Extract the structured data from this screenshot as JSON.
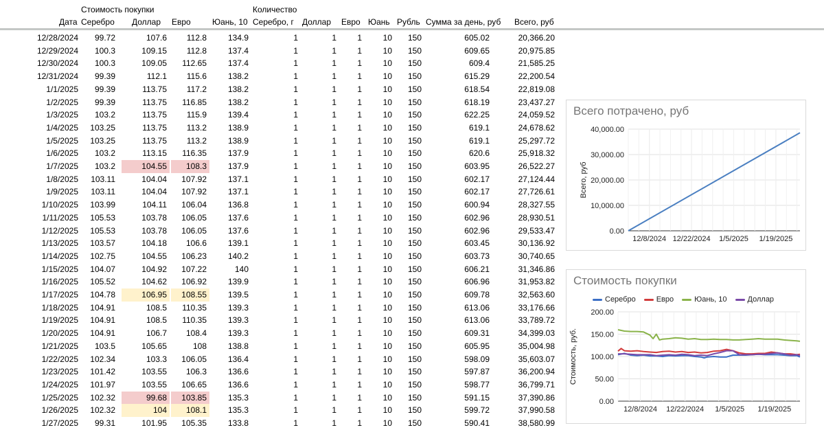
{
  "header": {
    "group_cost": "Стоимость покупки",
    "group_qty": "Количество",
    "columns": [
      "Дата",
      "Серебро",
      "Доллар",
      "Евро",
      "Юань, 10",
      "Серебро, г",
      "Доллар",
      "Евро",
      "Юань",
      "Рубль",
      "Сумма за день, руб",
      "Всего, руб"
    ]
  },
  "rows": [
    [
      "12/28/2024",
      "99.72",
      "107.6",
      "112.8",
      "134.9",
      "1",
      "1",
      "1",
      "10",
      "150",
      "605.02",
      "20,366.20"
    ],
    [
      "12/29/2024",
      "100.3",
      "109.15",
      "112.8",
      "137.4",
      "1",
      "1",
      "1",
      "10",
      "150",
      "609.65",
      "20,975.85"
    ],
    [
      "12/30/2024",
      "100.3",
      "109.05",
      "112.65",
      "137.4",
      "1",
      "1",
      "1",
      "10",
      "150",
      "609.4",
      "21,585.25"
    ],
    [
      "12/31/2024",
      "99.39",
      "112.1",
      "115.6",
      "138.2",
      "1",
      "1",
      "1",
      "10",
      "150",
      "615.29",
      "22,200.54"
    ],
    [
      "1/1/2025",
      "99.39",
      "113.75",
      "117.2",
      "138.2",
      "1",
      "1",
      "1",
      "10",
      "150",
      "618.54",
      "22,819.08"
    ],
    [
      "1/2/2025",
      "99.39",
      "113.75",
      "116.85",
      "138.2",
      "1",
      "1",
      "1",
      "10",
      "150",
      "618.19",
      "23,437.27"
    ],
    [
      "1/3/2025",
      "103.2",
      "113.75",
      "115.9",
      "139.4",
      "1",
      "1",
      "1",
      "10",
      "150",
      "622.25",
      "24,059.52"
    ],
    [
      "1/4/2025",
      "103.25",
      "113.75",
      "113.2",
      "138.9",
      "1",
      "1",
      "1",
      "10",
      "150",
      "619.1",
      "24,678.62"
    ],
    [
      "1/5/2025",
      "103.25",
      "113.75",
      "113.2",
      "138.9",
      "1",
      "1",
      "1",
      "10",
      "150",
      "619.1",
      "25,297.72"
    ],
    [
      "1/6/2025",
      "103.2",
      "113.15",
      "116.35",
      "137.9",
      "1",
      "1",
      "1",
      "10",
      "150",
      "620.6",
      "25,918.32"
    ],
    [
      "1/7/2025",
      "103.2",
      "104.55",
      "108.3",
      "137.9",
      "1",
      "1",
      "1",
      "10",
      "150",
      "603.95",
      "26,522.27"
    ],
    [
      "1/8/2025",
      "103.11",
      "104.04",
      "107.92",
      "137.1",
      "1",
      "1",
      "1",
      "10",
      "150",
      "602.17",
      "27,124.44"
    ],
    [
      "1/9/2025",
      "103.11",
      "104.04",
      "107.92",
      "137.1",
      "1",
      "1",
      "1",
      "10",
      "150",
      "602.17",
      "27,726.61"
    ],
    [
      "1/10/2025",
      "103.99",
      "104.11",
      "106.04",
      "136.8",
      "1",
      "1",
      "1",
      "10",
      "150",
      "600.94",
      "28,327.55"
    ],
    [
      "1/11/2025",
      "105.53",
      "103.78",
      "106.05",
      "137.6",
      "1",
      "1",
      "1",
      "10",
      "150",
      "602.96",
      "28,930.51"
    ],
    [
      "1/12/2025",
      "105.53",
      "103.78",
      "106.05",
      "137.6",
      "1",
      "1",
      "1",
      "10",
      "150",
      "602.96",
      "29,533.47"
    ],
    [
      "1/13/2025",
      "103.57",
      "104.18",
      "106.6",
      "139.1",
      "1",
      "1",
      "1",
      "10",
      "150",
      "603.45",
      "30,136.92"
    ],
    [
      "1/14/2025",
      "102.75",
      "104.55",
      "106.23",
      "140.2",
      "1",
      "1",
      "1",
      "10",
      "150",
      "603.73",
      "30,740.65"
    ],
    [
      "1/15/2025",
      "104.07",
      "104.92",
      "107.22",
      "140",
      "1",
      "1",
      "1",
      "10",
      "150",
      "606.21",
      "31,346.86"
    ],
    [
      "1/16/2025",
      "105.52",
      "104.62",
      "106.92",
      "139.9",
      "1",
      "1",
      "1",
      "10",
      "150",
      "606.96",
      "31,953.82"
    ],
    [
      "1/17/2025",
      "104.78",
      "106.95",
      "108.55",
      "139.5",
      "1",
      "1",
      "1",
      "10",
      "150",
      "609.78",
      "32,563.60"
    ],
    [
      "1/18/2025",
      "104.91",
      "108.5",
      "110.35",
      "139.3",
      "1",
      "1",
      "1",
      "10",
      "150",
      "613.06",
      "33,176.66"
    ],
    [
      "1/19/2025",
      "104.91",
      "108.5",
      "110.35",
      "139.3",
      "1",
      "1",
      "1",
      "10",
      "150",
      "613.06",
      "33,789.72"
    ],
    [
      "1/20/2025",
      "104.91",
      "106.7",
      "108.4",
      "139.3",
      "1",
      "1",
      "1",
      "10",
      "150",
      "609.31",
      "34,399.03"
    ],
    [
      "1/21/2025",
      "103.5",
      "105.65",
      "108",
      "138.8",
      "1",
      "1",
      "1",
      "10",
      "150",
      "605.95",
      "35,004.98"
    ],
    [
      "1/22/2025",
      "102.34",
      "103.3",
      "106.05",
      "136.4",
      "1",
      "1",
      "1",
      "10",
      "150",
      "598.09",
      "35,603.07"
    ],
    [
      "1/23/2025",
      "101.42",
      "103.55",
      "106.3",
      "136.6",
      "1",
      "1",
      "1",
      "10",
      "150",
      "597.87",
      "36,200.94"
    ],
    [
      "1/24/2025",
      "101.97",
      "103.55",
      "106.65",
      "136.6",
      "1",
      "1",
      "1",
      "10",
      "150",
      "598.77",
      "36,799.71"
    ],
    [
      "1/25/2025",
      "102.32",
      "99.68",
      "103.85",
      "135.3",
      "1",
      "1",
      "1",
      "10",
      "150",
      "591.15",
      "37,390.86"
    ],
    [
      "1/26/2025",
      "102.32",
      "104",
      "108.1",
      "135.3",
      "1",
      "1",
      "1",
      "10",
      "150",
      "599.72",
      "37,990.58"
    ],
    [
      "1/27/2025",
      "99.31",
      "101.95",
      "105.35",
      "133.8",
      "1",
      "1",
      "1",
      "10",
      "150",
      "590.41",
      "38,580.99"
    ]
  ],
  "highlights": [
    {
      "row": 10,
      "cols": [
        2,
        3
      ],
      "color": "#f4cccc"
    },
    {
      "row": 20,
      "cols": [
        2,
        3
      ],
      "color": "#fff2cc"
    },
    {
      "row": 28,
      "cols": [
        2,
        3
      ],
      "color": "#f4cccc"
    },
    {
      "row": 29,
      "cols": [
        2,
        3
      ],
      "color": "#fff2cc"
    }
  ],
  "chart_data": [
    {
      "type": "line",
      "title": "Всего потрачено, руб",
      "ylabel": "Всего, руб",
      "xlabel": "",
      "ylim": [
        0,
        40000
      ],
      "yticks": [
        "0.00",
        "10,000.00",
        "20,000.00",
        "30,000.00",
        "40,000.00"
      ],
      "xticks": [
        "12/8/2024",
        "12/22/2024",
        "1/5/2025",
        "1/19/2025"
      ],
      "xtick_days": [
        7,
        21,
        35,
        49
      ],
      "xrange_days": [
        0,
        57
      ],
      "series": [
        {
          "color": "#4a7fc1",
          "x_days": [
            0,
            57
          ],
          "values": [
            0,
            38580.99
          ]
        }
      ],
      "grid": true,
      "legend": "none"
    },
    {
      "type": "line",
      "title": "Стоимость покупки",
      "ylabel": "Стоимость, руб.",
      "xlabel": "",
      "ylim": [
        0,
        200
      ],
      "yticks": [
        "0.00",
        "50.00",
        "100.00",
        "150.00",
        "200.00"
      ],
      "xticks": [
        "12/8/2024",
        "12/22/2024",
        "1/5/2025",
        "1/19/2025"
      ],
      "xtick_days": [
        7,
        21,
        35,
        49
      ],
      "xrange_days": [
        0,
        57
      ],
      "legend": "top",
      "grid": true,
      "series": [
        {
          "name": "Серебро",
          "color": "#3b6fc6",
          "x_days": [
            0,
            2,
            4,
            6,
            8,
            10,
            12,
            14,
            16,
            18,
            20,
            22,
            24,
            26,
            27,
            28,
            30,
            32,
            34,
            36,
            38,
            40,
            42,
            44,
            46,
            48,
            50,
            52,
            54,
            56,
            57
          ],
          "values": [
            104,
            107,
            103,
            102,
            103,
            101,
            101,
            100,
            102,
            101,
            102,
            102,
            100,
            99,
            97,
            99,
            100,
            99,
            99,
            103,
            103,
            103,
            104,
            105,
            104,
            104,
            104,
            103,
            102,
            102,
            99
          ]
        },
        {
          "name": "Евро",
          "color": "#d23b3b",
          "x_days": [
            0,
            1,
            2,
            4,
            6,
            8,
            10,
            12,
            14,
            16,
            18,
            20,
            22,
            24,
            26,
            28,
            30,
            32,
            34,
            36,
            38,
            40,
            42,
            44,
            46,
            48,
            50,
            52,
            54,
            56,
            57
          ],
          "values": [
            112,
            118,
            113,
            112,
            113,
            111,
            110,
            109,
            111,
            112,
            110,
            111,
            109,
            110,
            108,
            109,
            112,
            113,
            116,
            113,
            108,
            106,
            106,
            107,
            107,
            110,
            108,
            106,
            106,
            104,
            105
          ]
        },
        {
          "name": "Юань, 10",
          "color": "#8ab34a",
          "x_days": [
            0,
            2,
            4,
            6,
            8,
            10,
            11,
            12,
            13,
            14,
            16,
            18,
            20,
            22,
            24,
            26,
            28,
            30,
            32,
            34,
            36,
            38,
            40,
            42,
            44,
            46,
            48,
            50,
            52,
            54,
            56,
            57
          ],
          "values": [
            160,
            157,
            156,
            156,
            155,
            148,
            140,
            150,
            137,
            139,
            140,
            142,
            141,
            139,
            140,
            138,
            138,
            139,
            138,
            138,
            137,
            137,
            138,
            139,
            140,
            139,
            139,
            139,
            137,
            136,
            135,
            134
          ]
        },
        {
          "name": "Доллар",
          "color": "#7a4aa8",
          "x_days": [
            0,
            2,
            4,
            6,
            8,
            10,
            12,
            14,
            16,
            18,
            20,
            22,
            24,
            26,
            28,
            30,
            32,
            34,
            36,
            38,
            40,
            42,
            44,
            46,
            48,
            50,
            52,
            54,
            56,
            57
          ],
          "values": [
            106,
            106,
            105,
            104,
            104,
            104,
            102,
            103,
            104,
            103,
            105,
            104,
            102,
            103,
            102,
            106,
            109,
            113,
            113,
            104,
            104,
            104,
            105,
            105,
            107,
            108,
            106,
            103,
            104,
            102
          ]
        }
      ]
    }
  ]
}
